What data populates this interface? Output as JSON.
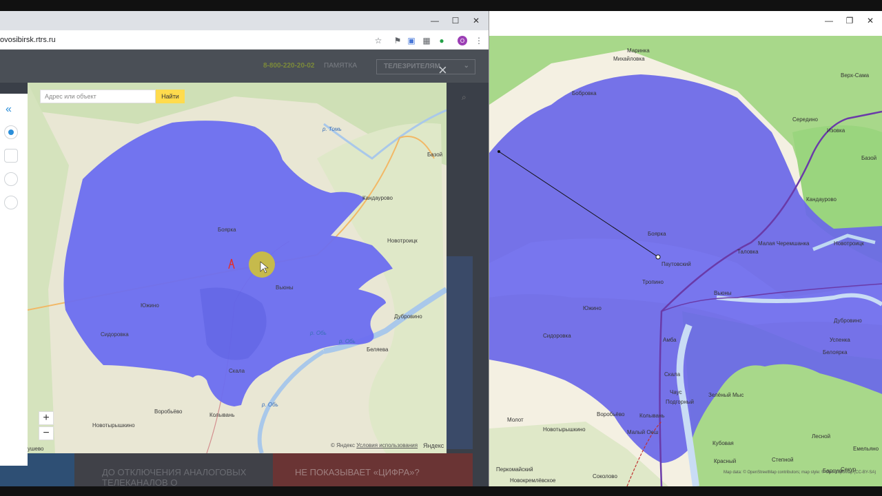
{
  "browser": {
    "url": "ovosibirsk.rtrs.ru",
    "window_controls": {
      "minimize": "—",
      "maximize": "☐",
      "close": "✕"
    }
  },
  "site": {
    "phone": "8-800-220-20-02",
    "memo_link": "ПАМЯТКА",
    "viewers_select": "ТЕЛЕЗРИТЕЛЯМ",
    "close_symbol": "×",
    "banner_1": "ДО ОТКЛЮЧЕНИЯ АНАЛОГОВЫХ ТЕЛЕКАНАЛОВ О",
    "banner_2": "НЕ ПОКАЗЫВАЕТ «ЦИФРА»?"
  },
  "modal": {
    "collapse_icon": "«",
    "search_placeholder": "Адрес или объект",
    "search_button": "Найти",
    "zoom_in": "+",
    "zoom_out": "−",
    "copyright": "© Яндекс",
    "terms_link": "Условия использования",
    "yandex_logo": "Яндекс"
  },
  "mapA": {
    "coverage_color": "#6b6ef0",
    "places": {
      "boyarka": "Боярка",
      "kandaurovo": "Кандаурово",
      "novotroitsk": "Новотроицк",
      "vyuny": "Вьюны",
      "yuzhino": "Южино",
      "sidorovka": "Сидоровка",
      "dubrovino": "Дубровино",
      "belyaeva": "Беляева",
      "skala": "Скала",
      "vorobyovo": "Воробьёво",
      "kolyvan": "Колывань",
      "novotyryshkino": "Новотырышкино",
      "bazoy": "Базой",
      "dushevo": "ушево"
    },
    "rivers": {
      "tom": "р. Томь",
      "ob1": "р. Обь",
      "ob2": "р. Обь",
      "ob3": "р. Обь"
    }
  },
  "rwin": {
    "window_controls": {
      "minimize": "—",
      "maximize": "❐",
      "close": "✕"
    },
    "attribution": "Map data: © OpenStreetMap contributors; map style: © OpenTopoMap (CC-BY-SA)"
  },
  "mapB": {
    "coverage_color": "#6a68e8",
    "places": {
      "marinka": "Маринка",
      "mikhailovka": "Михайловка",
      "bobrovka": "Бобровка",
      "verkh_sama": "Верх-Сама",
      "bazoy": "Базой",
      "izovka": "Изовка",
      "seredino": "Середино",
      "kandaurovo": "Кандаурово",
      "boyarka": "Боярка",
      "pautovskiy": "Паутовский",
      "talovka": "Таловка",
      "malaya_cheremshanka": "Малая Черемшанка",
      "novotroitsk": "Новотроицк",
      "tropino": "Тропино",
      "vyuny": "Вьюны",
      "yuzhino": "Южино",
      "sidorovka": "Сидоровка",
      "amba": "Амба",
      "dubrovino": "Дубровино",
      "uspenka": "Успенка",
      "skala": "Скала",
      "chaus": "Чаус",
      "podgorny": "Подгорный",
      "vorobyovo": "Воробьёво",
      "kolyvan": "Колывань",
      "maly_oesh": "Малый Оеш",
      "zelyony_mys": "Зелёный Мыс",
      "molot": "Молот",
      "novotyryshkino": "Новотырышкино",
      "kubovaya": "Кубовая",
      "krasny": "Красный",
      "stepnoy": "Степной",
      "sokolovo": "Соколово",
      "lesnoy": "Лесной",
      "emelyanovo": "Емельяно",
      "barsuki": "Барсуки",
      "sekur": "Секур",
      "perkomaysky": "Перкомайский",
      "novokremlevskoe": "Новокремлёвское",
      "beloyarka": "Белоярка"
    }
  }
}
